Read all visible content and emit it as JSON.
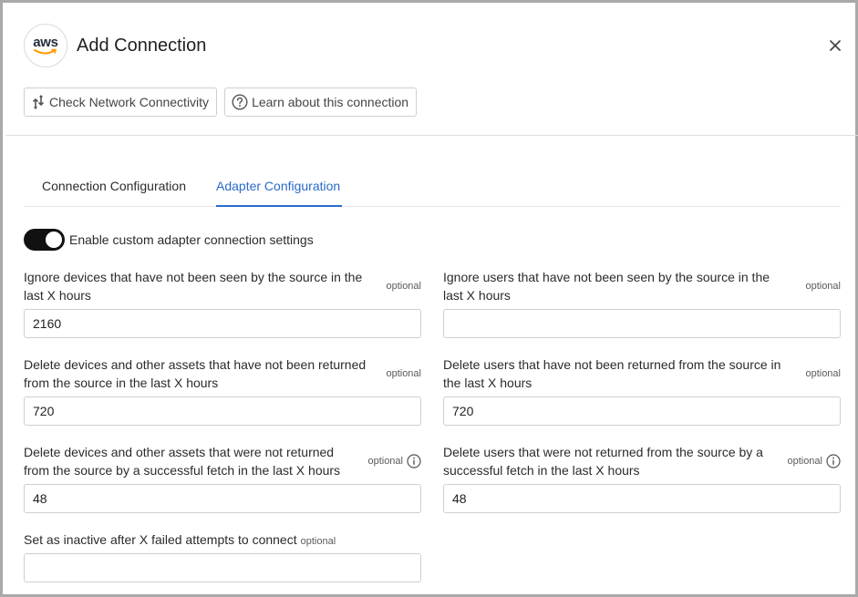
{
  "dialog": {
    "title": "Add Connection",
    "logo_text": "aws",
    "close_icon": "close-icon"
  },
  "toolbar": {
    "check_network_label": "Check Network Connectivity",
    "learn_label": "Learn about this connection"
  },
  "tabs": [
    {
      "label": "Connection Configuration",
      "active": false
    },
    {
      "label": "Adapter Configuration",
      "active": true
    }
  ],
  "toggle": {
    "label": "Enable custom adapter connection settings",
    "enabled": true
  },
  "fields": [
    {
      "label": "Ignore devices that have not been seen by the source in the last X hours",
      "optional": "optional",
      "value": "2160",
      "info": false
    },
    {
      "label": "Ignore users that have not been seen by the source in the last X hours",
      "optional": "optional",
      "value": "",
      "info": false
    },
    {
      "label": "Delete devices and other assets that have not been returned from the source in the last X hours",
      "optional": "optional",
      "value": "720",
      "info": false
    },
    {
      "label": "Delete users that have not been returned from the source in the last X hours",
      "optional": "optional",
      "value": "720",
      "info": false
    },
    {
      "label": "Delete devices and other assets that were not returned from the source by a successful fetch in the last X hours",
      "optional": "optional",
      "value": "48",
      "info": true
    },
    {
      "label": "Delete users that were not returned from the source by a successful fetch in the last X hours",
      "optional": "optional",
      "value": "48",
      "info": true
    },
    {
      "label": "Set as inactive after X failed attempts to connect",
      "optional": "optional",
      "value": "",
      "info": false
    }
  ],
  "colors": {
    "accent": "#2a6acb",
    "toggle_on": "#111111",
    "border": "#cfcfcf"
  }
}
